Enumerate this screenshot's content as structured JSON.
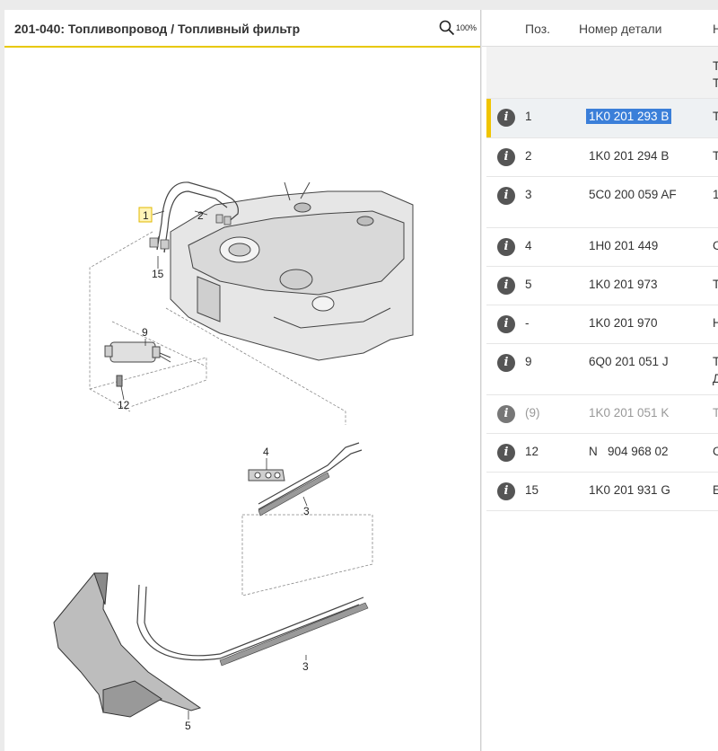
{
  "left": {
    "title": "201-040: Топливопровод / Топливный фильтр",
    "zoom_label": "100%",
    "callouts": [
      "1",
      "2",
      "15",
      "9",
      "12",
      "4",
      "3",
      "3",
      "5"
    ]
  },
  "table": {
    "columns": {
      "pos": "Поз.",
      "part": "Номер детали",
      "next": "Н"
    },
    "first_row": {
      "line1": "Т",
      "line2": "Т"
    },
    "rows": [
      {
        "pos": "1",
        "part": "1K0 201 293 B",
        "next": "Т",
        "next2": ""
      },
      {
        "pos": "2",
        "part": "1K0 201 294 B",
        "next": "Т",
        "next2": ""
      },
      {
        "pos": "3",
        "part": "5C0 200 059 AF",
        "next": "1",
        "next2": ""
      },
      {
        "pos": "4",
        "part": "1H0 201 449",
        "next": "С",
        "next2": ""
      },
      {
        "pos": "5",
        "part": "1K0 201 973",
        "next": "Т",
        "next2": ""
      },
      {
        "pos": "-",
        "part": "1K0 201 970",
        "next": "Н",
        "next2": ""
      },
      {
        "pos": "9",
        "part": "6Q0 201 051 J",
        "next": "Т",
        "next2": "Д"
      },
      {
        "pos": "(9)",
        "part": "1K0 201 051 K",
        "next": "Т",
        "next2": ""
      },
      {
        "pos": "12",
        "part": "N   904 968 02",
        "next": "С",
        "next2": ""
      },
      {
        "pos": "15",
        "part": "1K0 201 931 G",
        "next": "Е",
        "next2": ""
      }
    ]
  },
  "colors": {
    "accent": "#e8c800",
    "selection": "#3b7fd9",
    "icon": "#555555"
  }
}
